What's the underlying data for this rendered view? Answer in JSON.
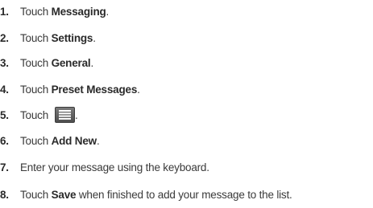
{
  "steps": [
    {
      "number": "1.",
      "prefix": "Touch ",
      "bold": "Messaging",
      "suffix": "."
    },
    {
      "number": "2.",
      "prefix": "Touch ",
      "bold": "Settings",
      "suffix": "."
    },
    {
      "number": "3.",
      "prefix": "Touch ",
      "bold": "General",
      "suffix": "."
    },
    {
      "number": "4.",
      "prefix": "Touch ",
      "bold": "Preset Messages",
      "suffix": "."
    },
    {
      "number": "5.",
      "prefix": "Touch",
      "icon": "list-menu-icon",
      "suffix": "."
    },
    {
      "number": "6.",
      "prefix": "Touch ",
      "bold": "Add New",
      "suffix": "."
    },
    {
      "number": "7.",
      "prefix": "Enter your message using the keyboard."
    },
    {
      "number": "8.",
      "prefix": "Touch ",
      "bold": "Save",
      "suffix": " when finished to add your message to the list."
    }
  ]
}
